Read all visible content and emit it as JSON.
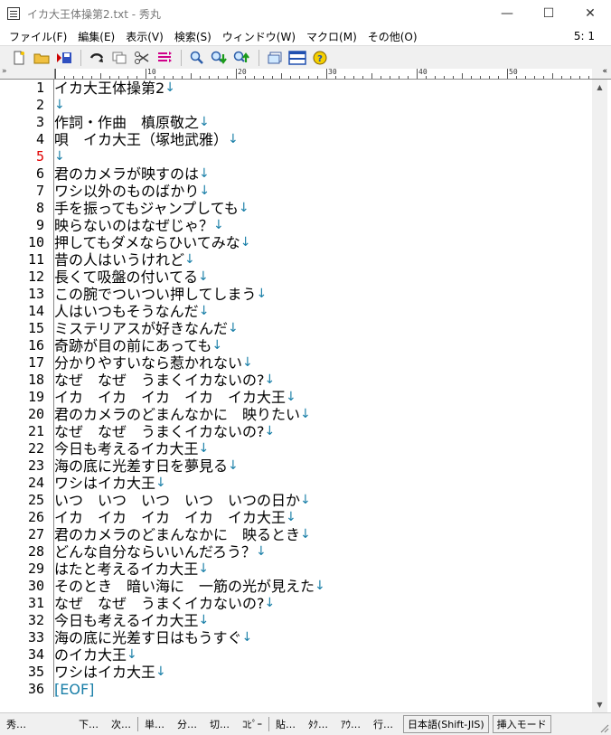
{
  "window": {
    "title": "イカ大王体操第2.txt - 秀丸",
    "minimize": "—",
    "maximize": "☐",
    "close": "✕"
  },
  "menu": {
    "items": [
      "ファイル(F)",
      "編集(E)",
      "表示(V)",
      "検索(S)",
      "ウィンドウ(W)",
      "マクロ(M)",
      "その他(O)"
    ],
    "cursor_pos": "5: 1"
  },
  "toolbar": {
    "icons": [
      "new-file-icon",
      "open-folder-icon",
      "save-icon",
      "undo-icon",
      "copy-icon",
      "cut-icon",
      "paste-icon",
      "find-icon",
      "find-down-icon",
      "find-up-icon",
      "window-list-icon",
      "split-window-icon",
      "help-icon"
    ]
  },
  "ruler": {
    "corner": "»",
    "labels": [
      "10",
      "20",
      "30",
      "40",
      "50"
    ],
    "arrow": "«"
  },
  "editor": {
    "newline_mark": "↓",
    "eof_mark": "[EOF]",
    "current_line": 5,
    "lines": [
      "イカ大王体操第2",
      "",
      "作詞・作曲　槙原敬之",
      "唄　イカ大王（塚地武雅）",
      "",
      "君のカメラが映すのは",
      "ワシ以外のものばかり",
      "手を振ってもジャンプしても",
      "映らないのはなぜじゃ？",
      "押してもダメならひいてみな",
      "昔の人はいうけれど",
      "長くて吸盤の付いてる",
      "この腕でついつい押してしまう",
      "人はいつもそうなんだ",
      "ミステリアスが好きなんだ",
      "奇跡が目の前にあっても",
      "分かりやすいなら惹かれない",
      "なぜ　なぜ　うまくイカないの?",
      "イカ　イカ　イカ　イカ　イカ大王",
      "君のカメラのどまんなかに　映りたい",
      "なぜ　なぜ　うまくイカないの?",
      "今日も考えるイカ大王",
      "海の底に光差す日を夢見る",
      "ワシはイカ大王",
      "いつ　いつ　いつ　いつ　いつの日か",
      "イカ　イカ　イカ　イカ　イカ大王",
      "君のカメラのどまんなかに　映るとき",
      "どんな自分ならいいんだろう？",
      "はたと考えるイカ大王",
      "そのとき　暗い海に　一筋の光が見えた",
      "なぜ　なぜ　うまくイカないの?",
      "今日も考えるイカ大王",
      "海の底に光差す日はもうすぐ",
      "のイカ大王",
      "ワシはイカ大王",
      ""
    ]
  },
  "status": {
    "items": [
      "秀…",
      "下…",
      "次…",
      "単…",
      "分…",
      "切…",
      "ｺﾋﾟｰ",
      "貼…",
      "ﾀｸ…",
      "ｱｳ…",
      "行…"
    ],
    "encoding": "日本語(Shift-JIS)",
    "mode": "挿入モード"
  }
}
